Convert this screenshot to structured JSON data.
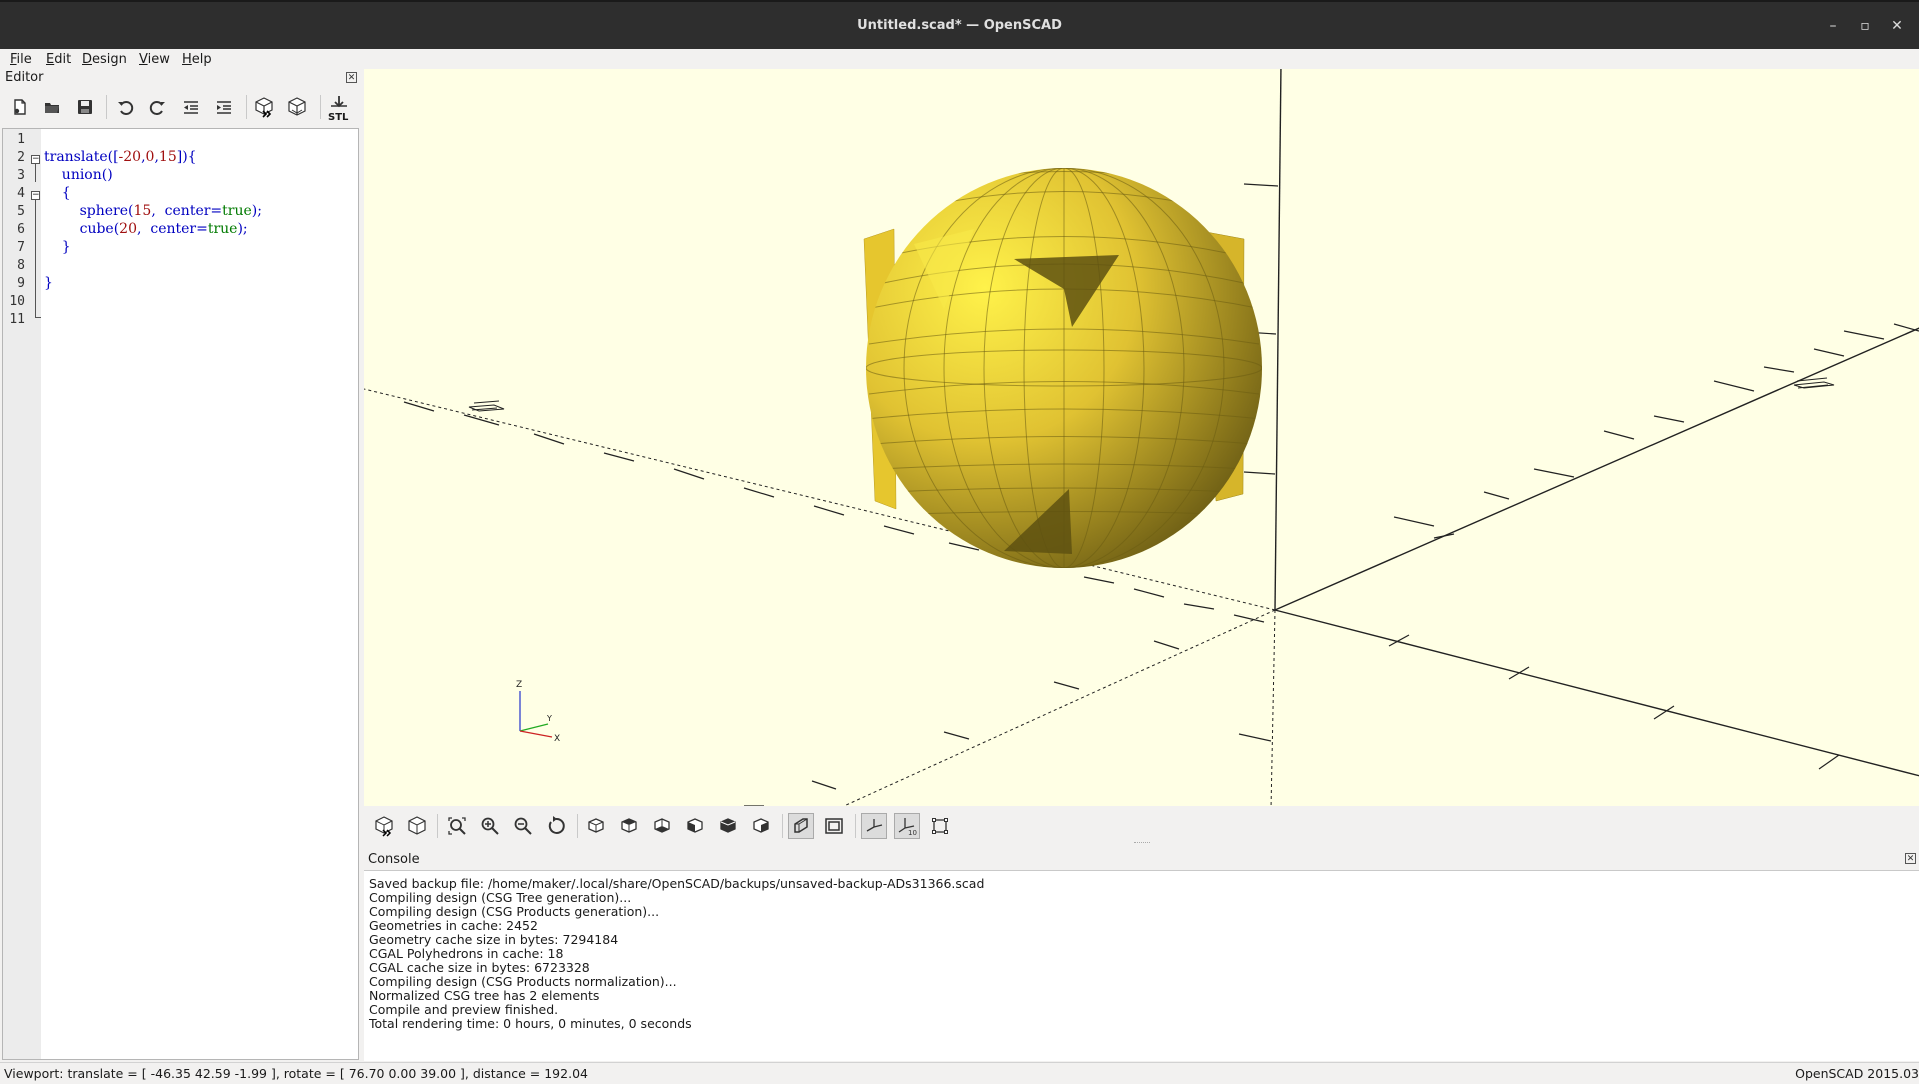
{
  "window": {
    "title": "Untitled.scad* — OpenSCAD",
    "controls": [
      "–",
      "▫",
      "✕"
    ]
  },
  "menu": {
    "items": [
      "File",
      "Edit",
      "Design",
      "View",
      "Help"
    ]
  },
  "editor": {
    "title": "Editor",
    "stl_label": "STL",
    "line_numbers": [
      "1",
      "2",
      "3",
      "4",
      "5",
      "6",
      "7",
      "8",
      "9",
      "10",
      "11"
    ],
    "lines": [
      "",
      "translate([-20,0,15]){",
      "    union()",
      "    {",
      "        sphere(15,  center=true);",
      "        cube(20,  center=true);",
      "    }",
      "",
      "}",
      "",
      ""
    ]
  },
  "viewport": {
    "background": "#ffffe5",
    "model_color": "#f0d030",
    "axis_labels": {
      "z": "Z",
      "y": "Y",
      "x": "X"
    }
  },
  "console": {
    "title": "Console",
    "lines": [
      "Saved backup file: /home/maker/.local/share/OpenSCAD/backups/unsaved-backup-ADs31366.scad",
      "Compiling design (CSG Tree generation)...",
      "Compiling design (CSG Products generation)...",
      "Geometries in cache: 2452",
      "Geometry cache size in bytes: 7294184",
      "CGAL Polyhedrons in cache: 18",
      "CGAL cache size in bytes: 6723328",
      "Compiling design (CSG Products normalization)...",
      "Normalized CSG tree has 2 elements",
      "Compile and preview finished.",
      "Total rendering time: 0 hours, 0 minutes, 0 seconds"
    ]
  },
  "status": {
    "viewport": "Viewport: translate = [ -46.35 42.59 -1.99 ], rotate = [ 76.70 0.00 39.00 ], distance = 192.04",
    "version": "OpenSCAD 2015.03"
  }
}
